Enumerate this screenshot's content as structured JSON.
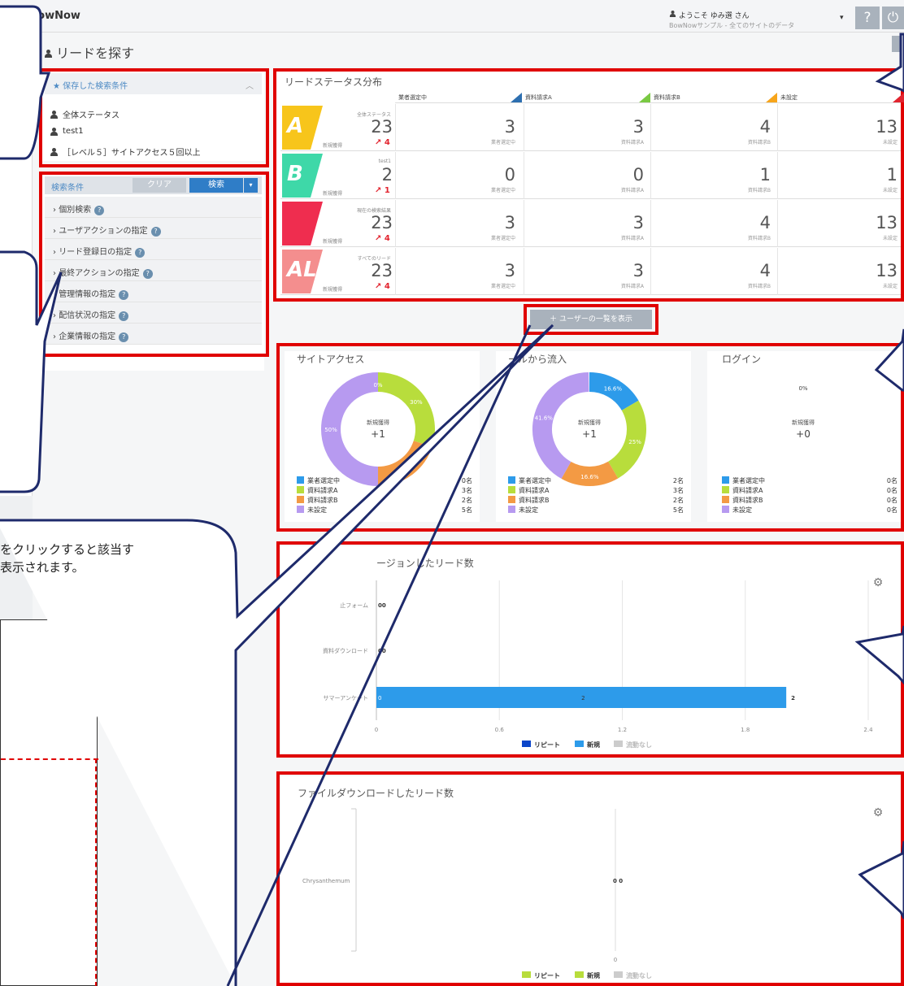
{
  "app": {
    "name": "BowNow",
    "user_greeting": "ようこそ ゆみ選 さん",
    "user_sub": "BowNowサンプル - 全てのサイトのデータ"
  },
  "page": {
    "title": "リードを探す"
  },
  "saved": {
    "title": "保存した検索条件",
    "items": [
      "全体ステータス",
      "test1",
      "［レベル５］サイトアクセス５回以上"
    ]
  },
  "search": {
    "title": "検索条件",
    "clear": "クリア",
    "search": "検索",
    "criteria": [
      "個別検索",
      "ユーザアクションの指定",
      "リード登録日の指定",
      "最終アクションの指定",
      "管理情報の指定",
      "配信状況の指定",
      "企業情報の指定"
    ]
  },
  "status": {
    "title": "リードステータス分布",
    "columns": [
      "業者選定中",
      "資料請求A",
      "資料請求B",
      "未設定"
    ],
    "new_label": "新規獲得",
    "rows": [
      {
        "label": "全体ステータス",
        "banner": "A",
        "total": "23",
        "delta": "4",
        "values": [
          "3",
          "3",
          "4",
          "13"
        ]
      },
      {
        "label": "test1",
        "banner": "B",
        "total": "2",
        "delta": "1",
        "values": [
          "0",
          "0",
          "1",
          "1"
        ]
      },
      {
        "label": "現在の検索結果",
        "banner": "",
        "total": "23",
        "delta": "4",
        "values": [
          "3",
          "3",
          "4",
          "13"
        ]
      },
      {
        "label": "すべてのリード",
        "banner": "ALL",
        "total": "23",
        "delta": "4",
        "values": [
          "3",
          "3",
          "4",
          "13"
        ]
      }
    ]
  },
  "show_users": "＋ ユーザーの一覧を表示",
  "donuts": [
    {
      "title": "サイトアクセス",
      "center_label": "新規獲得",
      "center_value": "+1",
      "pct": [
        "0%",
        "30%",
        "",
        "50%"
      ],
      "counts": [
        "0名",
        "3名",
        "2名",
        "5名"
      ]
    },
    {
      "title": "ールから流入",
      "center_label": "新規獲得",
      "center_value": "+1",
      "pct": [
        "16.6%",
        "25%",
        "16.6%",
        "41.6%"
      ],
      "counts": [
        "2名",
        "3名",
        "2名",
        "5名"
      ]
    },
    {
      "title": "ログイン",
      "center_label": "新規獲得",
      "center_value": "+0",
      "pct": [
        "0%"
      ],
      "counts": [
        "0名",
        "0名",
        "0名",
        "0名"
      ]
    }
  ],
  "legend_labels": [
    "業者選定中",
    "資料請求A",
    "資料請求B",
    "未設定"
  ],
  "colors": {
    "c1": "#2d9bea",
    "c2": "#b8dd3c",
    "c3": "#f39a44",
    "c4": "#b79af0",
    "red": "#e00000",
    "navy": "#1e2a6b"
  },
  "chart1": {
    "title": "ージョンしたリード数",
    "categories": [
      "止フォーム",
      "資料ダウンロード",
      "サマーアンケート"
    ],
    "ticks": [
      "0",
      "0.6",
      "1.2",
      "1.8",
      "2.4"
    ],
    "legend": [
      "リピート",
      "新規",
      "流動なし"
    ],
    "chart_data": {
      "type": "bar",
      "categories": [
        "止フォーム",
        "資料ダウンロード",
        "サマーアンケート"
      ],
      "series": [
        {
          "name": "リピート",
          "values": [
            0,
            0,
            0
          ]
        },
        {
          "name": "新規",
          "values": [
            0,
            0,
            2
          ]
        }
      ],
      "xlim": [
        0,
        2.4
      ]
    }
  },
  "chart2": {
    "title": "ファイルダウンロードしたリード数",
    "category": "Chrysanthemum",
    "tick": "0",
    "legend": [
      "リピート",
      "新規",
      "流動なし"
    ]
  },
  "bubble_text": [
    "をクリックすると該当す",
    "表示されます。"
  ]
}
